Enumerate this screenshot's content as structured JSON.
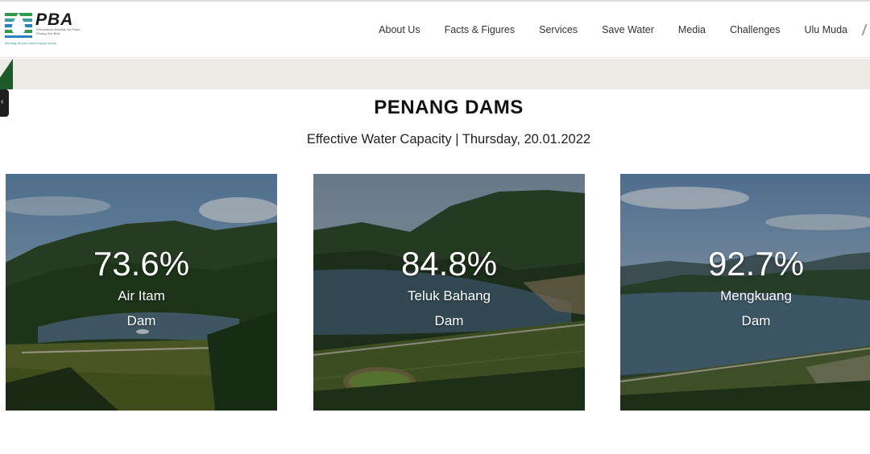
{
  "header": {
    "logo_text": "PBA",
    "logo_subtitle": "Perbadanan Bekalan Air Pulau Pinang Sdn Bhd",
    "logo_tagline": "Meeting all your water supply needs",
    "nav": [
      "About Us",
      "Facts & Figures",
      "Services",
      "Save Water",
      "Media",
      "Challenges",
      "Ulu Muda"
    ]
  },
  "page": {
    "title": "PENANG DAMS",
    "subtitle": "Effective Water Capacity | Thursday, 20.01.2022"
  },
  "dams": [
    {
      "percent": "73.6%",
      "name": "Air Itam",
      "suffix": "Dam"
    },
    {
      "percent": "84.8%",
      "name": "Teluk Bahang",
      "suffix": "Dam"
    },
    {
      "percent": "92.7%",
      "name": "Mengkuang",
      "suffix": "Dam"
    }
  ],
  "colors": {
    "banner": "#eeebe6",
    "logo_green": "#2e9a4a",
    "logo_blue": "#2a7fc0",
    "side_tab": "#1f1f1f"
  },
  "icons": {
    "logo_mark": "water-drop-logo-icon",
    "side_tab": "chevron-left-icon"
  }
}
